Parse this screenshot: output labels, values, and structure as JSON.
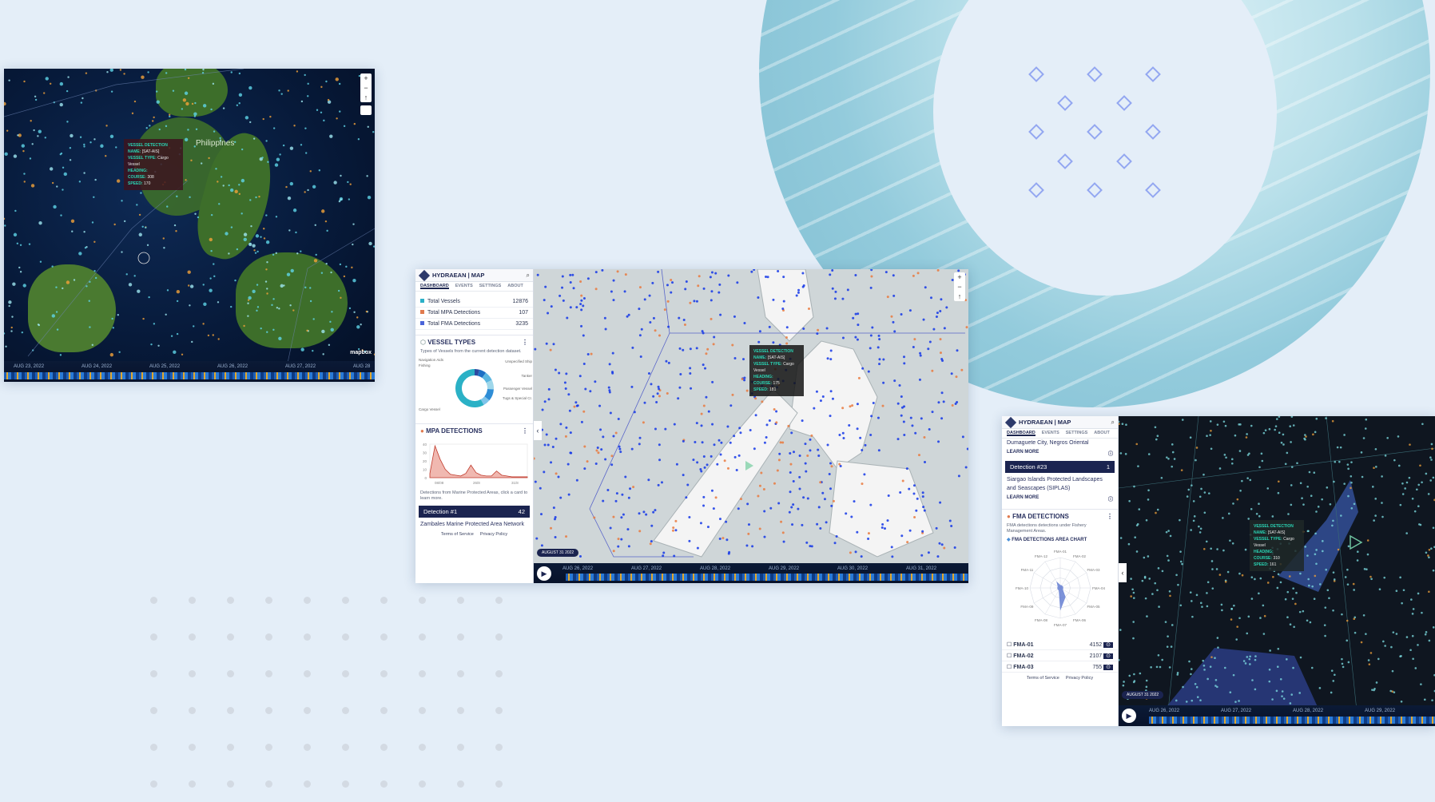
{
  "colors": {
    "background": "#e4eef8",
    "accent_teal": "#2ad4b4",
    "brand_navy": "#1b2450",
    "diamond": "#93a7f1",
    "mpa": "#e07a4e",
    "fma": "#4a64d9",
    "vessel_blue": "#1437e8"
  },
  "window1": {
    "map_label": "Philippines",
    "attribution": "mapbox",
    "tooltip": {
      "title": "VESSEL DETECTION",
      "name_label": "NAME:",
      "name_value": "[SAT-AIS]",
      "type_label": "VESSEL TYPE:",
      "type_value": "Cargo Vessel",
      "heading_label": "HEADING:",
      "course_label": "COURSE:",
      "course_value": "308",
      "speed_label": "SPEED:",
      "speed_value": "170"
    },
    "timeline": [
      "AUG 23, 2022",
      "AUG 24, 2022",
      "AUG 25, 2022",
      "AUG 26, 2022",
      "AUG 27, 2022",
      "AUG 28"
    ]
  },
  "window2": {
    "app_title": "HYDRAEAN | MAP",
    "tabs": [
      "DASHBOARD",
      "EVENTS",
      "SETTINGS",
      "ABOUT"
    ],
    "stats": [
      {
        "label": "Total Vessels",
        "value": "12876"
      },
      {
        "label": "Total MPA Detections",
        "value": "107"
      },
      {
        "label": "Total FMA Detections",
        "value": "3235"
      }
    ],
    "vessel_types": {
      "title": "VESSEL TYPES",
      "desc": "Types of Vessels from the current detection dataset.",
      "labels": [
        "Navigation Aids",
        "Fishing",
        "Unspecified Ship",
        "Tanker",
        "Passenger Vessel",
        "Tugs & Special Cr.",
        "Cargo Vessel"
      ],
      "shares": [
        0.04,
        0.06,
        0.08,
        0.08,
        0.1,
        0.06,
        0.58
      ]
    },
    "mpa": {
      "title": "MPA DETECTIONS",
      "y_ticks": [
        "40",
        "30",
        "20",
        "10",
        "0"
      ],
      "x_ticks": [
        "08/08",
        "26/8",
        "31/8"
      ],
      "values": [
        5,
        38,
        22,
        10,
        4,
        3,
        2,
        5,
        15,
        6,
        3,
        2,
        2,
        8,
        3,
        2,
        1,
        1,
        1,
        1
      ],
      "desc": "Detections from Marine Protected Areas, click a card to learn more."
    },
    "detection": {
      "label": "Detection #1",
      "count": "42",
      "area": "Zambales Marine Protected Area Network"
    },
    "footer": {
      "terms": "Terms of Service",
      "privacy": "Privacy Policy"
    },
    "tooltip": {
      "title": "VESSEL DETECTION",
      "name_label": "NAME:",
      "name_value": "[SAT-AIS]",
      "type_label": "VESSEL TYPE:",
      "type_value": "Cargo Vessel",
      "heading_label": "HEADING:",
      "course_label": "COURSE:",
      "course_value": "175",
      "speed_label": "SPEED:",
      "speed_value": "181"
    },
    "date_badge": "AUGUST 31 2022",
    "timeline": [
      "AUG 26, 2022",
      "AUG 27, 2022",
      "AUG 28, 2022",
      "AUG 29, 2022",
      "AUG 30, 2022",
      "AUG 31, 2022"
    ]
  },
  "window3": {
    "app_title": "HYDRAEAN | MAP",
    "tabs": [
      "DASHBOARD",
      "EVENTS",
      "SETTINGS",
      "ABOUT"
    ],
    "prev_area": "Dumaguete City, Negros Oriental",
    "learn_more": "LEARN MORE",
    "detection": {
      "label": "Detection #23",
      "count": "1",
      "area": "Siargao Islands Protected Landscapes and Seascapes (SIPLAS)"
    },
    "fma": {
      "title": "FMA DETECTIONS",
      "desc": "FMA detections detections under Fishery Management Areas.",
      "chart_title": "FMA DETECTIONS AREA CHART",
      "axes": [
        "FMA-01",
        "FMA-02",
        "FMA-03",
        "FMA-04",
        "FMA-05",
        "FMA-06",
        "FMA-07",
        "FMA-08",
        "FMA-09",
        "FMA-10",
        "FMA-11",
        "FMA-12"
      ],
      "rows": [
        {
          "label": "FMA-01",
          "value": "4152"
        },
        {
          "label": "FMA-02",
          "value": "2107"
        },
        {
          "label": "FMA-03",
          "value": "755"
        }
      ]
    },
    "footer": {
      "terms": "Terms of Service",
      "privacy": "Privacy Policy"
    },
    "tooltip": {
      "title": "VESSEL DETECTION",
      "name_label": "NAME:",
      "name_value": "[SAT-AIS]",
      "type_label": "VESSEL TYPE:",
      "type_value": "Cargo Vessel",
      "heading_label": "HEADING:",
      "course_label": "COURSE:",
      "course_value": "310",
      "speed_label": "SPEED:",
      "speed_value": "161"
    },
    "date_badge": "AUGUST 31 2022",
    "timeline": [
      "AUG 26, 2022",
      "AUG 27, 2022",
      "AUG 28, 2022",
      "AUG 29, 2022"
    ]
  }
}
